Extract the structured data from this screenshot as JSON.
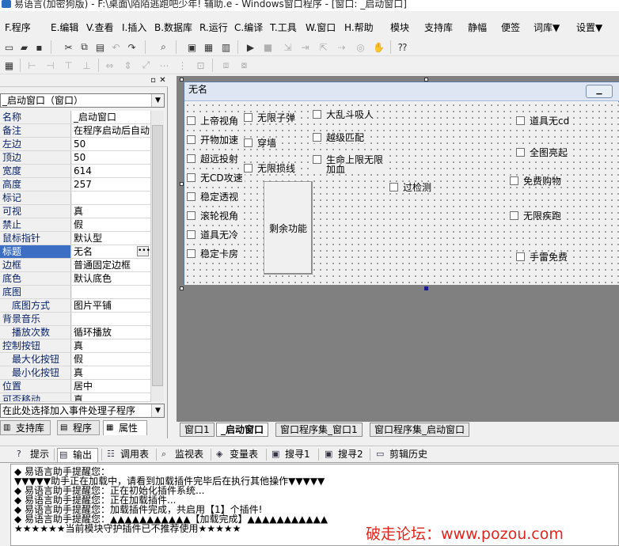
{
  "title_bar": {
    "title": "易语言(加密狗版) - F:\\桌面\\陌陌逃跑吧少年! 辅助.e - Windows窗口程序 - [窗口: _启动窗口]"
  },
  "menu": [
    {
      "label": "F.程序"
    },
    {
      "label": "E.编辑"
    },
    {
      "label": "V.查看"
    },
    {
      "label": "I.插入"
    },
    {
      "label": "B.数据库"
    },
    {
      "label": "R.运行"
    },
    {
      "label": "C.编译"
    },
    {
      "label": "T.工具"
    },
    {
      "label": "W.窗口"
    },
    {
      "label": "H.帮助"
    },
    {
      "label": "模块"
    },
    {
      "label": "支持库"
    },
    {
      "label": "静幅"
    },
    {
      "label": "便签"
    },
    {
      "label": "词库▼"
    },
    {
      "label": "设置▼"
    }
  ],
  "left_panel": {
    "object_combo": "_启动窗口（窗口）",
    "event_combo": "在此处选择加入事件处理子程序",
    "properties": [
      {
        "name": "名称",
        "value": "_启动窗口"
      },
      {
        "name": "备注",
        "value": "在程序启动后自动"
      },
      {
        "name": "左边",
        "value": "50"
      },
      {
        "name": "顶边",
        "value": "50"
      },
      {
        "name": "宽度",
        "value": "614"
      },
      {
        "name": "高度",
        "value": "257"
      },
      {
        "name": "标记",
        "value": ""
      },
      {
        "name": "可视",
        "value": "真"
      },
      {
        "name": "禁止",
        "value": "假"
      },
      {
        "name": "鼠标指针",
        "value": "默认型"
      },
      {
        "name": "标题",
        "value": "无名"
      },
      {
        "name": "边框",
        "value": "普通固定边框"
      },
      {
        "name": "底色",
        "value": "默认底色"
      },
      {
        "name": "底图",
        "value": ""
      },
      {
        "name": "底图方式",
        "value": "图片平铺"
      },
      {
        "name": "背景音乐",
        "value": ""
      },
      {
        "name": "播放次数",
        "value": "循环播放"
      },
      {
        "name": "控制按钮",
        "value": "真"
      },
      {
        "name": "最大化按钮",
        "value": "假"
      },
      {
        "name": "最小化按钮",
        "value": "真"
      },
      {
        "name": "位置",
        "value": "居中"
      },
      {
        "name": "可否移动",
        "value": "真"
      }
    ],
    "tabs": [
      {
        "label": "支持库"
      },
      {
        "label": "程序"
      },
      {
        "label": "属性"
      }
    ]
  },
  "form": {
    "title": "无名",
    "checkboxes": [
      {
        "label": "上帝视角"
      },
      {
        "label": "开物加速"
      },
      {
        "label": "超远投射"
      },
      {
        "label": "无CD攻速"
      },
      {
        "label": "稳定透视"
      },
      {
        "label": "滚轮视角"
      },
      {
        "label": "道具无冷"
      },
      {
        "label": "稳定卡房"
      },
      {
        "label": "无限子弹"
      },
      {
        "label": "穿墙"
      },
      {
        "label": "无限损线"
      },
      {
        "label": "大乱斗吸人"
      },
      {
        "label": "越级匹配"
      },
      {
        "label": "生命上限无限"
      },
      {
        "label": "加血"
      },
      {
        "label": "过检测"
      },
      {
        "label": "道具无cd"
      },
      {
        "label": "全图亮起"
      },
      {
        "label": "免费购物"
      },
      {
        "label": "无限疾跑"
      },
      {
        "label": "手雷免费"
      }
    ],
    "button_label": "剩余功能"
  },
  "code_tabs": [
    {
      "label": "窗口1"
    },
    {
      "label": "_启动窗口"
    },
    {
      "label": "窗口程序集_窗口1"
    },
    {
      "label": "窗口程序集_启动窗口"
    }
  ],
  "bottom_tabs": [
    {
      "label": "提示"
    },
    {
      "label": "输出"
    },
    {
      "label": "调用表"
    },
    {
      "label": "监视表"
    },
    {
      "label": "变量表"
    },
    {
      "label": "搜寻1"
    },
    {
      "label": "搜寻2"
    },
    {
      "label": "剪辑历史"
    }
  ],
  "output_lines": [
    "◆ 易语言助手提醒您：",
    "▼▼▼▼▼助手正在加载中，请看到加载插件完毕后在执行其他操作▼▼▼▼▼",
    "◆ 易语言助手提醒您：正在初始化插件系统...",
    "◆ 易语言助手提醒您：正在加载插件...",
    "◆ 易语言助手提醒您：加载插件完成，共启用【1】个插件!",
    "◆ 易语言助手提醒您：▲▲▲▲▲▲▲▲▲▲▲【加载完成】▲▲▲▲▲▲▲▲▲▲▲",
    "★★★★★★当前模块守护插件已不推荐使用★★★★★"
  ],
  "watermark": "破走论坛：www.pozou.com"
}
